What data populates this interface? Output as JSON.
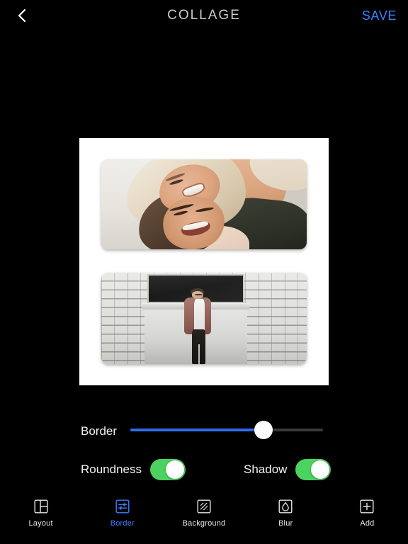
{
  "header": {
    "back_icon": "chevron-left-icon",
    "title": "COLLAGE",
    "save_label": "SAVE",
    "save_color": "#3d7eff",
    "title_color": "#c9c9cf"
  },
  "canvas": {
    "background_color": "#ffffff",
    "photos": [
      {
        "name": "photo-couple-laughing",
        "alt": "Blonde woman and dark-haired man laughing together"
      },
      {
        "name": "photo-man-brick-wall",
        "alt": "Man in pink jacket standing against white brick wall"
      }
    ]
  },
  "controls": {
    "border": {
      "label": "Border",
      "value_percent": 69,
      "fill_color": "#2f6df0",
      "track_color": "#3a3a3a",
      "thumb_color": "#fdfdfd"
    },
    "roundness": {
      "label": "Roundness",
      "state": "on",
      "on_color": "#4cd35f"
    },
    "shadow": {
      "label": "Shadow",
      "state": "on",
      "on_color": "#4cd35f"
    }
  },
  "tabbar": {
    "active_color": "#3d7eff",
    "items": [
      {
        "label": "Layout",
        "icon": "layout-grid-icon",
        "active": false
      },
      {
        "label": "Border",
        "icon": "border-sliders-icon",
        "active": true
      },
      {
        "label": "Background",
        "icon": "background-pattern-icon",
        "active": false
      },
      {
        "label": "Blur",
        "icon": "blur-droplet-icon",
        "active": false
      },
      {
        "label": "Add",
        "icon": "add-plus-icon",
        "active": false
      }
    ]
  }
}
